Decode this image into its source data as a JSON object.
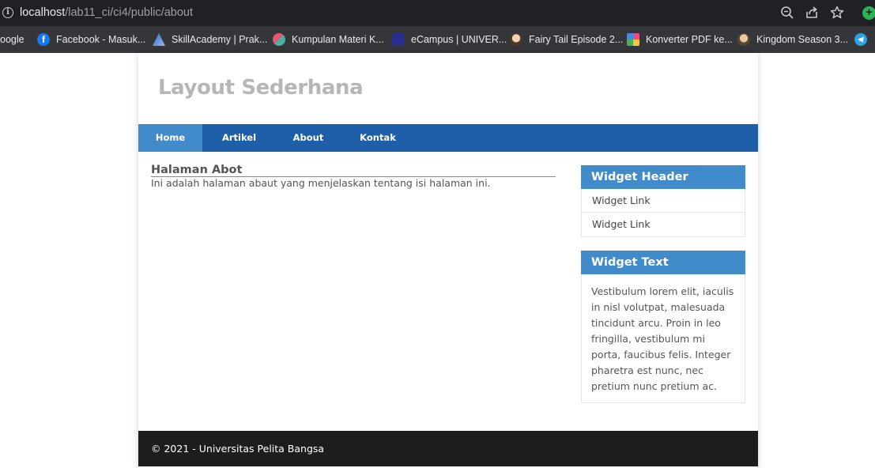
{
  "browser": {
    "url_host": "localhost",
    "url_path": "/lab11_ci/ci4/public/about",
    "bookmarks": [
      {
        "label": "oogle",
        "icon": "google-icon",
        "color": "#35363a"
      },
      {
        "label": "Facebook - Masuk...",
        "icon": "facebook-icon",
        "color": "#1877f2"
      },
      {
        "label": "SkillAcademy | Prak...",
        "icon": "skillacademy-icon",
        "color": "#5b8fd6"
      },
      {
        "label": "Kumpulan Materi K...",
        "icon": "materi-icon",
        "color": "#d9486a"
      },
      {
        "label": "eCampus | UNIVER...",
        "icon": "ecampus-icon",
        "color": "#2a2f8f"
      },
      {
        "label": "Fairy Tail Episode 2...",
        "icon": "fairytail-icon",
        "color": "#c9a27a"
      },
      {
        "label": "Konverter PDF ke...",
        "icon": "pdf-converter-icon",
        "color": "#e84d8a"
      },
      {
        "label": "Kingdom Season 3...",
        "icon": "kingdom-icon",
        "color": "#b08968"
      },
      {
        "label": "",
        "icon": "telegram-icon",
        "color": "#2aa3df"
      }
    ]
  },
  "site": {
    "title": "Layout Sederhana",
    "nav": [
      "Home",
      "Artikel",
      "About",
      "Kontak"
    ],
    "active_nav": "Home"
  },
  "content": {
    "title": "Halaman Abot",
    "text": "Ini adalah halaman abaut yang menjelaskan tentang isi halaman ini."
  },
  "sidebar": {
    "widget1": {
      "header": "Widget Header",
      "links": [
        "Widget Link",
        "Widget Link"
      ]
    },
    "widget2": {
      "header": "Widget Text",
      "text": "Vestibulum lorem elit, iaculis in nisl volutpat, malesuada tincidunt arcu. Proin in leo fringilla, vestibulum mi porta, faucibus felis. Integer pharetra est nunc, nec pretium nunc pretium ac."
    }
  },
  "footer": {
    "text": "© 2021 - Universitas Pelita Bangsa"
  },
  "colors": {
    "nav_bg": "#1f5faa",
    "nav_active": "#428bca",
    "widget_header": "#428bca",
    "footer_bg": "#1d1d1d"
  }
}
